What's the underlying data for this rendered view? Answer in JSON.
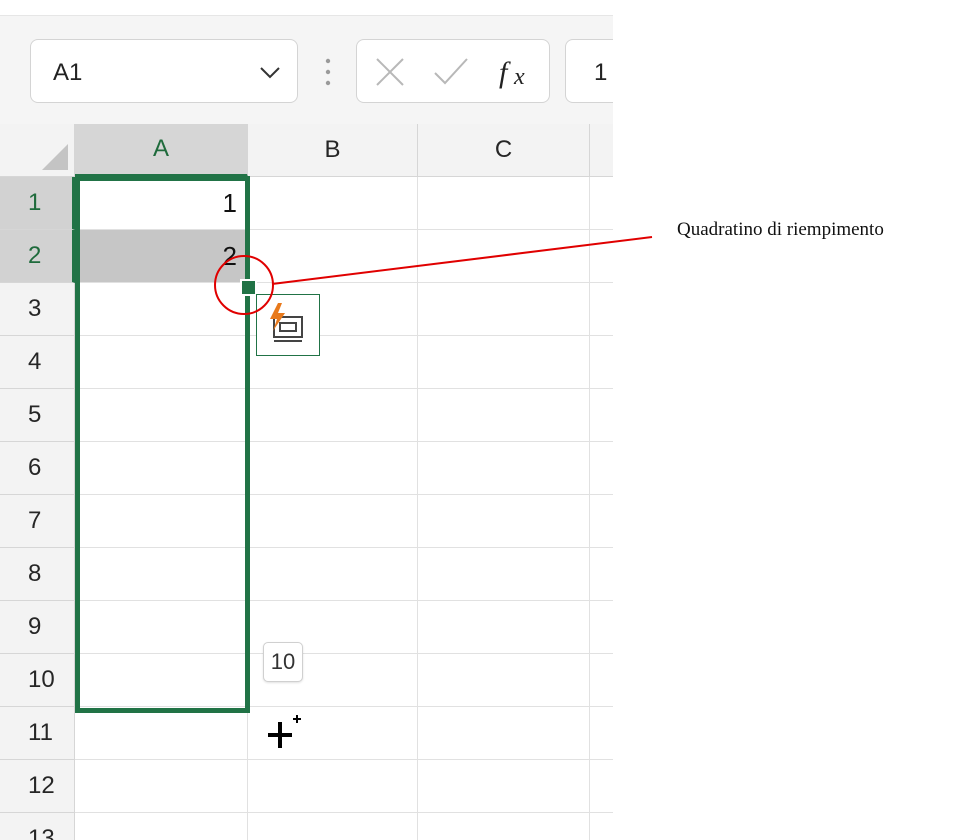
{
  "formula_bar": {
    "name_box_value": "A1",
    "formula_value": "1",
    "cancel_icon": "close-icon",
    "enter_icon": "checkmark-icon",
    "function_icon": "function-fx-icon"
  },
  "sheet": {
    "columns": [
      "A",
      "B",
      "C"
    ],
    "selected_column": "A",
    "rows": [
      "1",
      "2",
      "3",
      "4",
      "5",
      "6",
      "7",
      "8",
      "9",
      "10",
      "11",
      "12",
      "13"
    ],
    "selected_rows": [
      "1",
      "2"
    ],
    "cells": {
      "A1": "1",
      "A2": "2"
    }
  },
  "autofill": {
    "options_icon": "autofill-options-icon",
    "tooltip_value": "10",
    "cursor_icon": "fill-crosshair-icon"
  },
  "annotation": {
    "label": "Quadratino di riempimento"
  },
  "colors": {
    "selection_green": "#217346",
    "annotation_red": "#e00000",
    "header_bg": "#f3f3f3",
    "selected_cell_bg": "#c6c6c6"
  }
}
